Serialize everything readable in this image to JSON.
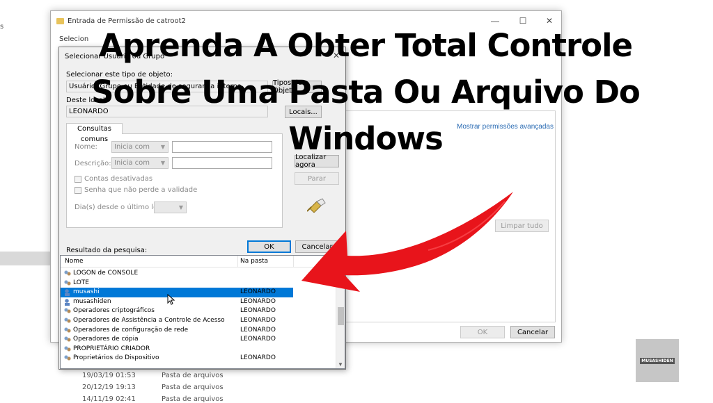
{
  "background": {
    "left_text": "s",
    "rows": [
      {
        "date": "19/03/19 01:53",
        "type": "Pasta de arquivos"
      },
      {
        "date": "20/12/19 19:13",
        "type": "Pasta de arquivos"
      },
      {
        "date": "14/11/19 02:41",
        "type": "Pasta de arquivos"
      }
    ]
  },
  "perm_window": {
    "title": "Entrada de Permissão de catroot2",
    "minimize": "—",
    "maximize": "☐",
    "close": "✕",
    "truncated_label": "Selecion",
    "advanced_link": "Mostrar permissões avançadas",
    "clear_all": "Limpar tudo",
    "ok": "OK",
    "cancel": "Cancelar"
  },
  "select_dialog": {
    "title": "Selecionar Usuário ou Grupo",
    "close": "✕",
    "object_type_label": "Selecionar este tipo de objeto:",
    "object_type_value": "Usuário, Grupo ou Entidade de segurança interna",
    "object_types_button": "Tipos de Objeto...",
    "location_label": "Deste local:",
    "location_value": "LEONARDO",
    "locations_button": "Locais...",
    "tab_label": "Consultas comuns",
    "name_label": "Nome:",
    "name_combo": "Inicia com",
    "description_label": "Descrição:",
    "description_combo": "Inicia com",
    "disabled_accounts": "Contas desativadas",
    "non_expiring_password": "Senha que não perde a validade",
    "days_since_logon": "Dia(s) desde o último logon:",
    "search_now_button": "Localizar agora",
    "stop_button": "Parar",
    "ok": "OK",
    "cancel": "Cancelar",
    "results_label": "Resultado da pesquisa:",
    "col_name": "Nome",
    "col_folder": "Na pasta",
    "scroll_up": "▲",
    "scroll_down": "▼",
    "results": [
      {
        "name": "LOGON de CONSOLE",
        "folder": "",
        "icon": "group-icon"
      },
      {
        "name": "LOTE",
        "folder": "",
        "icon": "group-icon"
      },
      {
        "name": "musashi",
        "folder": "LEONARDO",
        "icon": "user-icon"
      },
      {
        "name": "musashiden",
        "folder": "LEONARDO",
        "icon": "user-icon"
      },
      {
        "name": "Operadores criptográficos",
        "folder": "LEONARDO",
        "icon": "group-icon"
      },
      {
        "name": "Operadores de Assistência a Controle de Acesso",
        "folder": "LEONARDO",
        "icon": "group-icon"
      },
      {
        "name": "Operadores de configuração de rede",
        "folder": "LEONARDO",
        "icon": "group-icon"
      },
      {
        "name": "Operadores de cópia",
        "folder": "LEONARDO",
        "icon": "group-icon"
      },
      {
        "name": "PROPRIETÁRIO CRIADOR",
        "folder": "",
        "icon": "group-icon"
      },
      {
        "name": "Proprietários do Dispositivo",
        "folder": "LEONARDO",
        "icon": "group-icon"
      }
    ],
    "selected_index": 2
  },
  "headline": [
    "Aprenda A Obter Total Controle",
    "Sobre Uma Pasta Ou Arquivo Do",
    "Windows"
  ],
  "watermark": "MUSASHIDEN",
  "colors": {
    "arrow": "#e8141b",
    "selection": "#0078d7",
    "link": "#2a6bb3"
  }
}
